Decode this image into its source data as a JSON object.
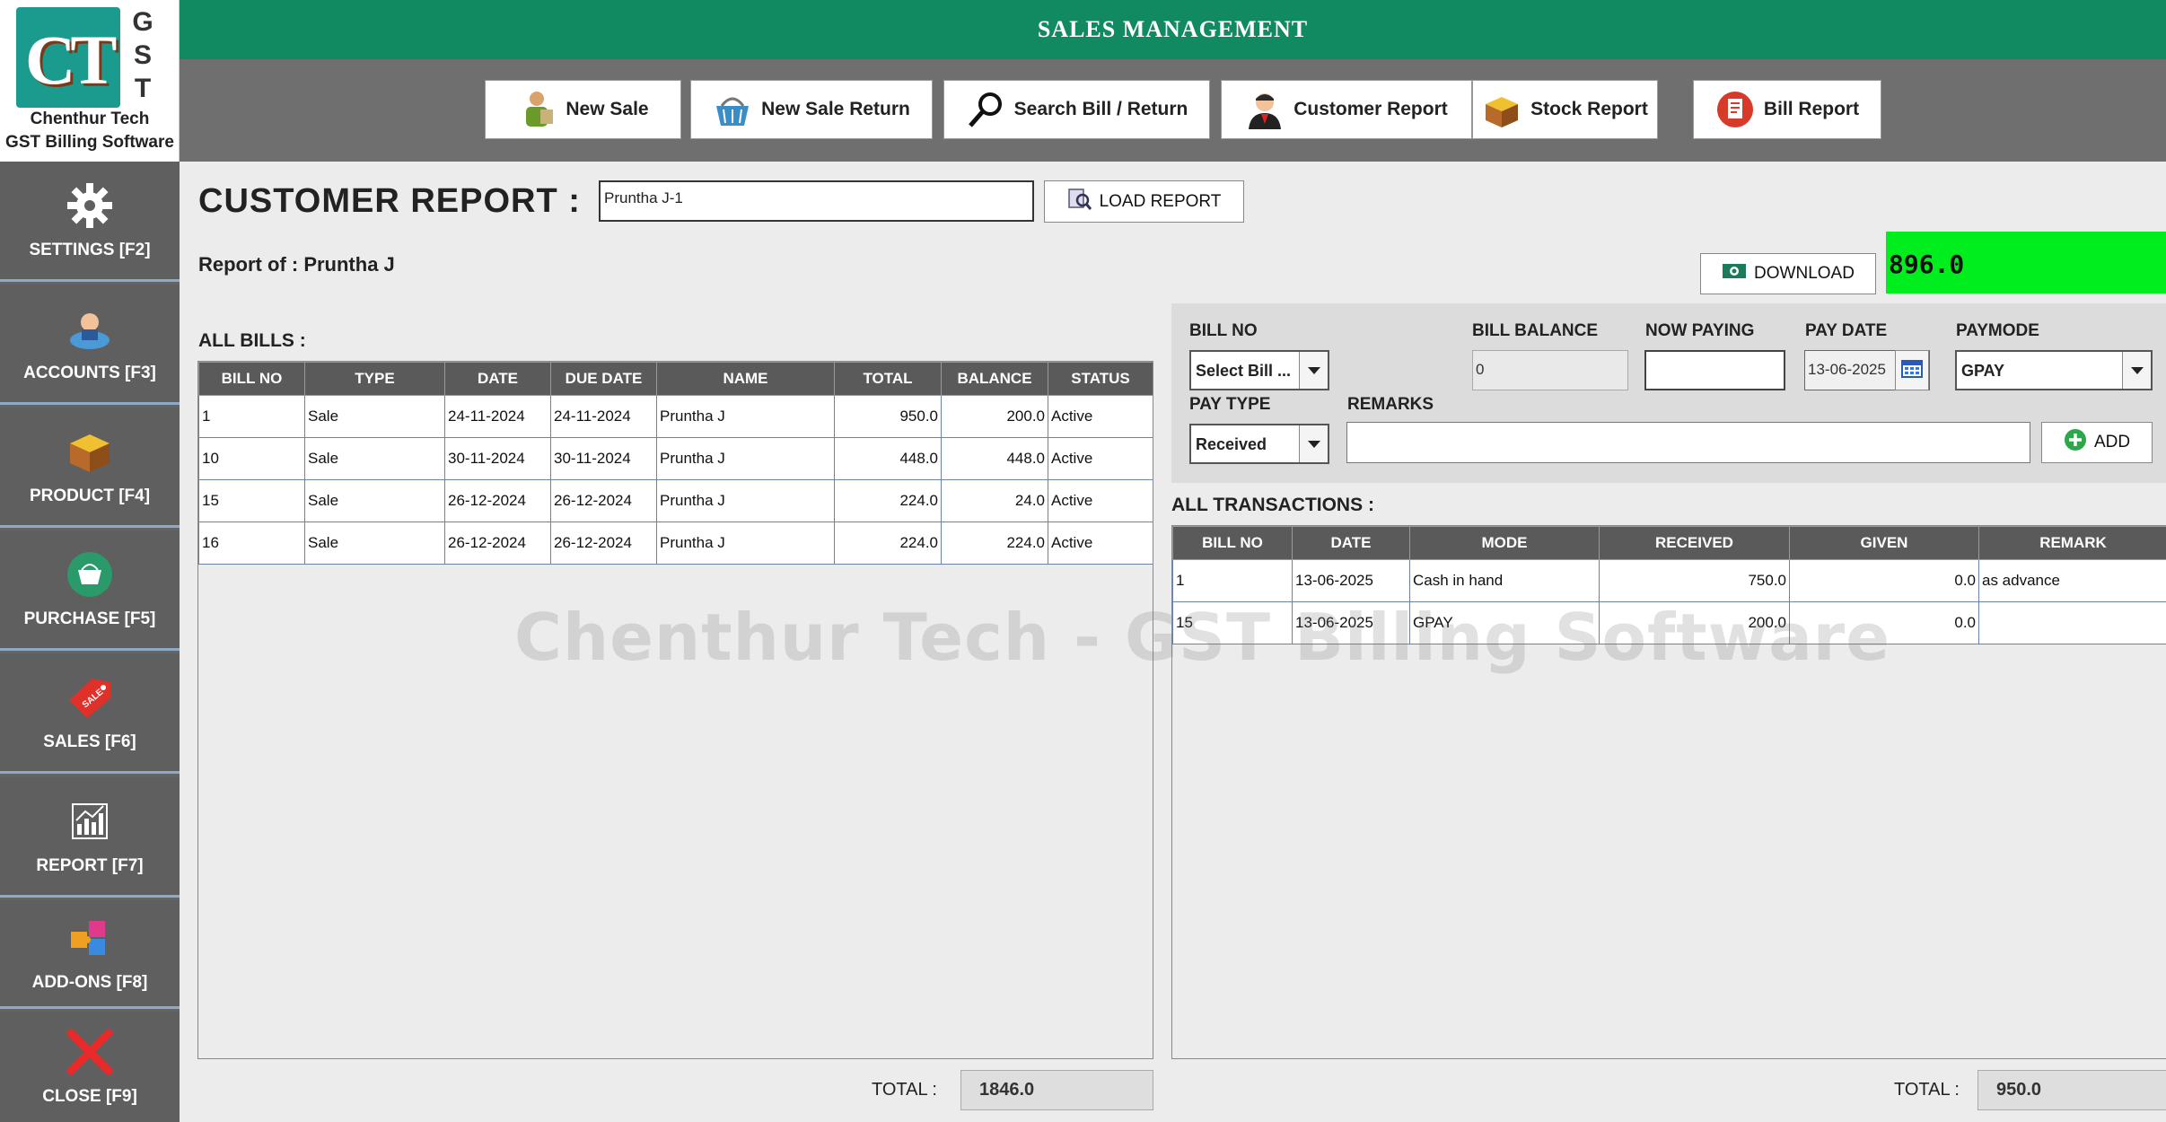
{
  "logo": {
    "line1": "Chenthur Tech",
    "line2": "GST Billing Software",
    "gst": [
      "G",
      "S",
      "T"
    ],
    "mark": "CT"
  },
  "header": {
    "title": "SALES MANAGEMENT"
  },
  "nav": [
    {
      "label": "New Sale",
      "icon": "new-sale-icon"
    },
    {
      "label": "New Sale Return",
      "icon": "basket-icon"
    },
    {
      "label": "Search Bill / Return",
      "icon": "magnifier-icon"
    },
    {
      "label": "Customer Report",
      "icon": "customer-icon"
    },
    {
      "label": "Stock Report",
      "icon": "box-icon"
    },
    {
      "label": "Bill Report",
      "icon": "bill-icon"
    }
  ],
  "sidebar": [
    {
      "label": "SETTINGS [F2]",
      "icon": "gear-icon"
    },
    {
      "label": "ACCOUNTS [F3]",
      "icon": "accounts-icon"
    },
    {
      "label": "PRODUCT [F4]",
      "icon": "product-box-icon"
    },
    {
      "label": "PURCHASE [F5]",
      "icon": "purchase-basket-icon"
    },
    {
      "label": "SALES [F6]",
      "icon": "sale-tag-icon"
    },
    {
      "label": "REPORT [F7]",
      "icon": "report-chart-icon"
    },
    {
      "label": "ADD-ONS [F8]",
      "icon": "addons-puzzle-icon"
    },
    {
      "label": "CLOSE [F9]",
      "icon": "close-x-icon"
    }
  ],
  "report": {
    "title": "CUSTOMER REPORT :",
    "customer_value": "Pruntha  J-1",
    "load_label": "LOAD REPORT",
    "report_of": "Report of : Pruntha J",
    "download_label": "DOWNLOAD",
    "balance_amount": "896.0"
  },
  "bills": {
    "label": "ALL BILLS :",
    "columns": [
      "BILL  NO",
      "TYPE",
      "DATE",
      "DUE DATE",
      "NAME",
      "TOTAL",
      "BALANCE",
      "STATUS"
    ],
    "rows": [
      [
        "1",
        "Sale",
        "24-11-2024",
        "24-11-2024",
        "Pruntha  J",
        "950.0",
        "200.0",
        "Active"
      ],
      [
        "10",
        "Sale",
        "30-11-2024",
        "30-11-2024",
        "Pruntha  J",
        "448.0",
        "448.0",
        "Active"
      ],
      [
        "15",
        "Sale",
        "26-12-2024",
        "26-12-2024",
        "Pruntha  J",
        "224.0",
        "24.0",
        "Active"
      ],
      [
        "16",
        "Sale",
        "26-12-2024",
        "26-12-2024",
        "Pruntha  J",
        "224.0",
        "224.0",
        "Active"
      ]
    ],
    "total_label": "TOTAL :",
    "total_value": "1846.0"
  },
  "payment": {
    "bill_no_label": "BILL NO",
    "bill_no_value": "Select Bill ...",
    "bill_balance_label": "BILL BALANCE",
    "bill_balance_value": "0",
    "now_paying_label": "NOW PAYING",
    "now_paying_value": "",
    "pay_date_label": "PAY DATE",
    "pay_date_value": "13-06-2025",
    "paymode_label": "PAYMODE",
    "paymode_value": "GPAY",
    "pay_type_label": "PAY TYPE",
    "pay_type_value": "Received",
    "remarks_label": "REMARKS",
    "remarks_value": "",
    "add_label": "ADD"
  },
  "transactions": {
    "label": "ALL TRANSACTIONS :",
    "columns": [
      "BILL  NO",
      "DATE",
      "MODE",
      "RECEIVED",
      "GIVEN",
      "REMARK"
    ],
    "rows": [
      [
        "1",
        "13-06-2025",
        "Cash  in  hand",
        "750.0",
        "0.0",
        "as  advance"
      ],
      [
        "15",
        "13-06-2025",
        "GPAY",
        "200.0",
        "0.0",
        ""
      ]
    ],
    "total_label": "TOTAL :",
    "total_value": "950.0"
  },
  "watermark": "Chenthur Tech - GST Billing Software"
}
